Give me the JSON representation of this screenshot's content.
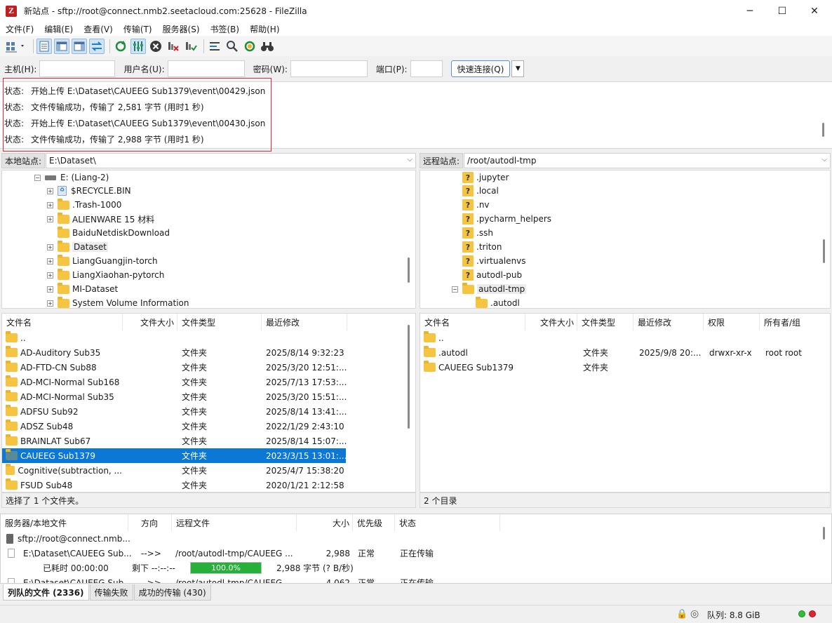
{
  "window": {
    "title": "新站点 - sftp://root@connect.nmb2.seetacloud.com:25628 - FileZilla",
    "app_icon": "Z",
    "minimize": "─",
    "maximize": "☐",
    "close": "✕"
  },
  "menu": [
    "文件(F)",
    "编辑(E)",
    "查看(V)",
    "传输(T)",
    "服务器(S)",
    "书签(B)",
    "帮助(H)"
  ],
  "toolbar_icons": [
    "site-manager-icon",
    "toggle-log-icon",
    "toggle-local-tree-icon",
    "toggle-remote-tree-icon",
    "toggle-queue-icon",
    "refresh-icon",
    "process-queue-icon",
    "cancel-icon",
    "disconnect-icon",
    "reconnect-icon",
    "directory-listing-filters-icon",
    "compare-icon",
    "sync-browse-icon",
    "search-icon"
  ],
  "quickconnect": {
    "host_label": "主机(H):",
    "user_label": "用户名(U):",
    "pass_label": "密码(W):",
    "port_label": "端口(P):",
    "host_value": "",
    "user_value": "",
    "pass_value": "",
    "port_value": "",
    "button": "快速连接(Q)",
    "dropdown": "▼"
  },
  "log": [
    {
      "label": "状态:",
      "text": "开始上传 E:\\Dataset\\CAUEEG Sub1379\\event\\00429.json"
    },
    {
      "label": "状态:",
      "text": "文件传输成功，传输了 2,581 字节 (用时1 秒)"
    },
    {
      "label": "状态:",
      "text": "开始上传 E:\\Dataset\\CAUEEG Sub1379\\event\\00430.json"
    },
    {
      "label": "状态:",
      "text": "文件传输成功，传输了 2,988 字节 (用时1 秒)"
    }
  ],
  "local": {
    "site_label": "本地站点:",
    "path": "E:\\Dataset\\",
    "drive": "E: (Liang-2)",
    "tree": [
      {
        "name": "$RECYCLE.BIN",
        "icon": "recycle-bin-icon"
      },
      {
        "name": ".Trash-1000",
        "icon": "folder-icon"
      },
      {
        "name": "ALIENWARE 15 材料",
        "icon": "folder-icon"
      },
      {
        "name": "BaiduNetdiskDownload",
        "icon": "folder-icon"
      },
      {
        "name": "Dataset",
        "icon": "folder-icon"
      },
      {
        "name": "LiangGuangjin-torch",
        "icon": "folder-icon"
      },
      {
        "name": "LiangXiaohan-pytorch",
        "icon": "folder-icon"
      },
      {
        "name": "MI-Dataset",
        "icon": "folder-icon"
      },
      {
        "name": "System Volume Information",
        "icon": "folder-icon"
      }
    ],
    "columns": [
      "文件名",
      "文件大小",
      "文件类型",
      "最近修改"
    ],
    "files": [
      {
        "name": "..",
        "size": "",
        "type": "",
        "modified": ""
      },
      {
        "name": "AD-Auditory Sub35",
        "size": "",
        "type": "文件夹",
        "modified": "2025/8/14 9:32:23"
      },
      {
        "name": "AD-FTD-CN Sub88",
        "size": "",
        "type": "文件夹",
        "modified": "2025/3/20 12:51:..."
      },
      {
        "name": "AD-MCI-Normal Sub168",
        "size": "",
        "type": "文件夹",
        "modified": "2025/7/13 17:53:..."
      },
      {
        "name": "AD-MCI-Normal Sub35",
        "size": "",
        "type": "文件夹",
        "modified": "2025/3/20 15:51:..."
      },
      {
        "name": "ADFSU Sub92",
        "size": "",
        "type": "文件夹",
        "modified": "2025/8/14 13:41:..."
      },
      {
        "name": "ADSZ Sub48",
        "size": "",
        "type": "文件夹",
        "modified": "2022/1/29 2:43:10"
      },
      {
        "name": "BRAINLAT Sub67",
        "size": "",
        "type": "文件夹",
        "modified": "2025/8/14 15:07:..."
      },
      {
        "name": "CAUEEG Sub1379",
        "size": "",
        "type": "文件夹",
        "modified": "2023/3/15 13:01:..."
      },
      {
        "name": "Cognitive(subtraction, ...",
        "size": "",
        "type": "文件夹",
        "modified": "2025/4/7 15:38:20"
      },
      {
        "name": "FSUD Sub48",
        "size": "",
        "type": "文件夹",
        "modified": "2020/1/21 2:12:58"
      }
    ],
    "status": "选择了 1 个文件夹。"
  },
  "remote": {
    "site_label": "远程站点:",
    "path": "/root/autodl-tmp",
    "tree": [
      {
        "name": ".jupyter",
        "icon": "unknown-folder-icon"
      },
      {
        "name": ".local",
        "icon": "unknown-folder-icon"
      },
      {
        "name": ".nv",
        "icon": "unknown-folder-icon"
      },
      {
        "name": ".pycharm_helpers",
        "icon": "unknown-folder-icon"
      },
      {
        "name": ".ssh",
        "icon": "unknown-folder-icon"
      },
      {
        "name": ".triton",
        "icon": "unknown-folder-icon"
      },
      {
        "name": ".virtualenvs",
        "icon": "unknown-folder-icon"
      },
      {
        "name": "autodl-pub",
        "icon": "unknown-folder-icon"
      },
      {
        "name": "autodl-tmp",
        "icon": "folder-icon"
      },
      {
        "name": ".autodl",
        "icon": "folder-icon"
      }
    ],
    "columns": [
      "文件名",
      "文件大小",
      "文件类型",
      "最近修改",
      "权限",
      "所有者/组"
    ],
    "files": [
      {
        "name": "..",
        "size": "",
        "type": "",
        "modified": "",
        "perm": "",
        "owner": ""
      },
      {
        "name": ".autodl",
        "size": "",
        "type": "文件夹",
        "modified": "2025/9/8 20:...",
        "perm": "drwxr-xr-x",
        "owner": "root root"
      },
      {
        "name": "CAUEEG Sub1379",
        "size": "",
        "type": "文件夹",
        "modified": "",
        "perm": "",
        "owner": ""
      }
    ],
    "status": "2 个目录"
  },
  "queue": {
    "columns": [
      "服务器/本地文件",
      "方向",
      "远程文件",
      "大小",
      "优先级",
      "状态"
    ],
    "server": "sftp://root@connect.nmb...",
    "rows": [
      {
        "local": "E:\\Dataset\\CAUEEG Sub...",
        "dir": "-->>",
        "remote": "/root/autodl-tmp/CAUEEG ...",
        "size": "2,988",
        "priority": "正常",
        "status": "正在传输"
      },
      {
        "local": "E:\\Dataset\\CAUEEG Sub...",
        "dir": "-->>",
        "remote": "/root/autodl-tmp/CAUEEG ...",
        "size": "4,062",
        "priority": "正常",
        "status": "正在传输"
      }
    ],
    "elapsed": "已耗时 00:00:00",
    "remaining": "剩下 --:--:--",
    "progress_percent": 100,
    "progress_text": "100.0%",
    "bytes": "2,988 字节 (? B/秒)"
  },
  "tabs": [
    "列队的文件 (2336)",
    "传输失败",
    "成功的传输 (430)"
  ],
  "statusbar": {
    "queue": "队列: 8.8 GiB"
  }
}
